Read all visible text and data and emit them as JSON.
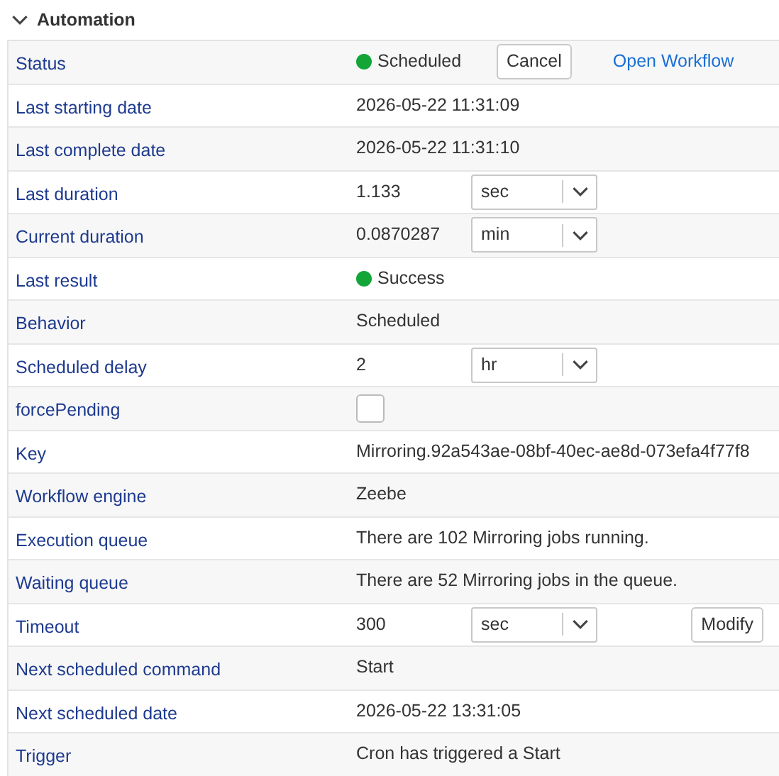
{
  "section": {
    "title": "Automation",
    "expanded": true
  },
  "rows": [
    {
      "label": "Status",
      "kind": "status",
      "value": "Scheduled",
      "color": "#13a538",
      "button": "Cancel",
      "link": "Open Workflow"
    },
    {
      "label": "Last starting date",
      "kind": "text",
      "value": "2026-05-22 11:31:09"
    },
    {
      "label": "Last complete date",
      "kind": "text",
      "value": "2026-05-22 11:31:10"
    },
    {
      "label": "Last duration",
      "kind": "unit",
      "value": "1.133",
      "unit": "sec"
    },
    {
      "label": "Current duration",
      "kind": "unit",
      "value": "0.0870287",
      "unit": "min"
    },
    {
      "label": "Last result",
      "kind": "status",
      "value": "Success",
      "color": "#13a538"
    },
    {
      "label": "Behavior",
      "kind": "text",
      "value": "Scheduled"
    },
    {
      "label": "Scheduled delay",
      "kind": "unit",
      "value": "2",
      "unit": "hr"
    },
    {
      "label": "forcePending",
      "kind": "checkbox",
      "checked": false
    },
    {
      "label": "Key",
      "kind": "text",
      "value": "Mirroring.92a543ae-08bf-40ec-ae8d-073efa4f77f8"
    },
    {
      "label": "Workflow engine",
      "kind": "text",
      "value": "Zeebe"
    },
    {
      "label": "Execution queue",
      "kind": "text",
      "value": "There are 102 Mirroring jobs running."
    },
    {
      "label": "Waiting queue",
      "kind": "text",
      "value": "There are 52 Mirroring jobs in the queue."
    },
    {
      "label": "Timeout",
      "kind": "unit",
      "value": "300",
      "unit": "sec",
      "button": "Modify"
    },
    {
      "label": "Next scheduled command",
      "kind": "text",
      "value": "Start"
    },
    {
      "label": "Next scheduled date",
      "kind": "text",
      "value": "2026-05-22 13:31:05"
    },
    {
      "label": "Trigger",
      "kind": "text",
      "value": "Cron has triggered a Start"
    }
  ]
}
